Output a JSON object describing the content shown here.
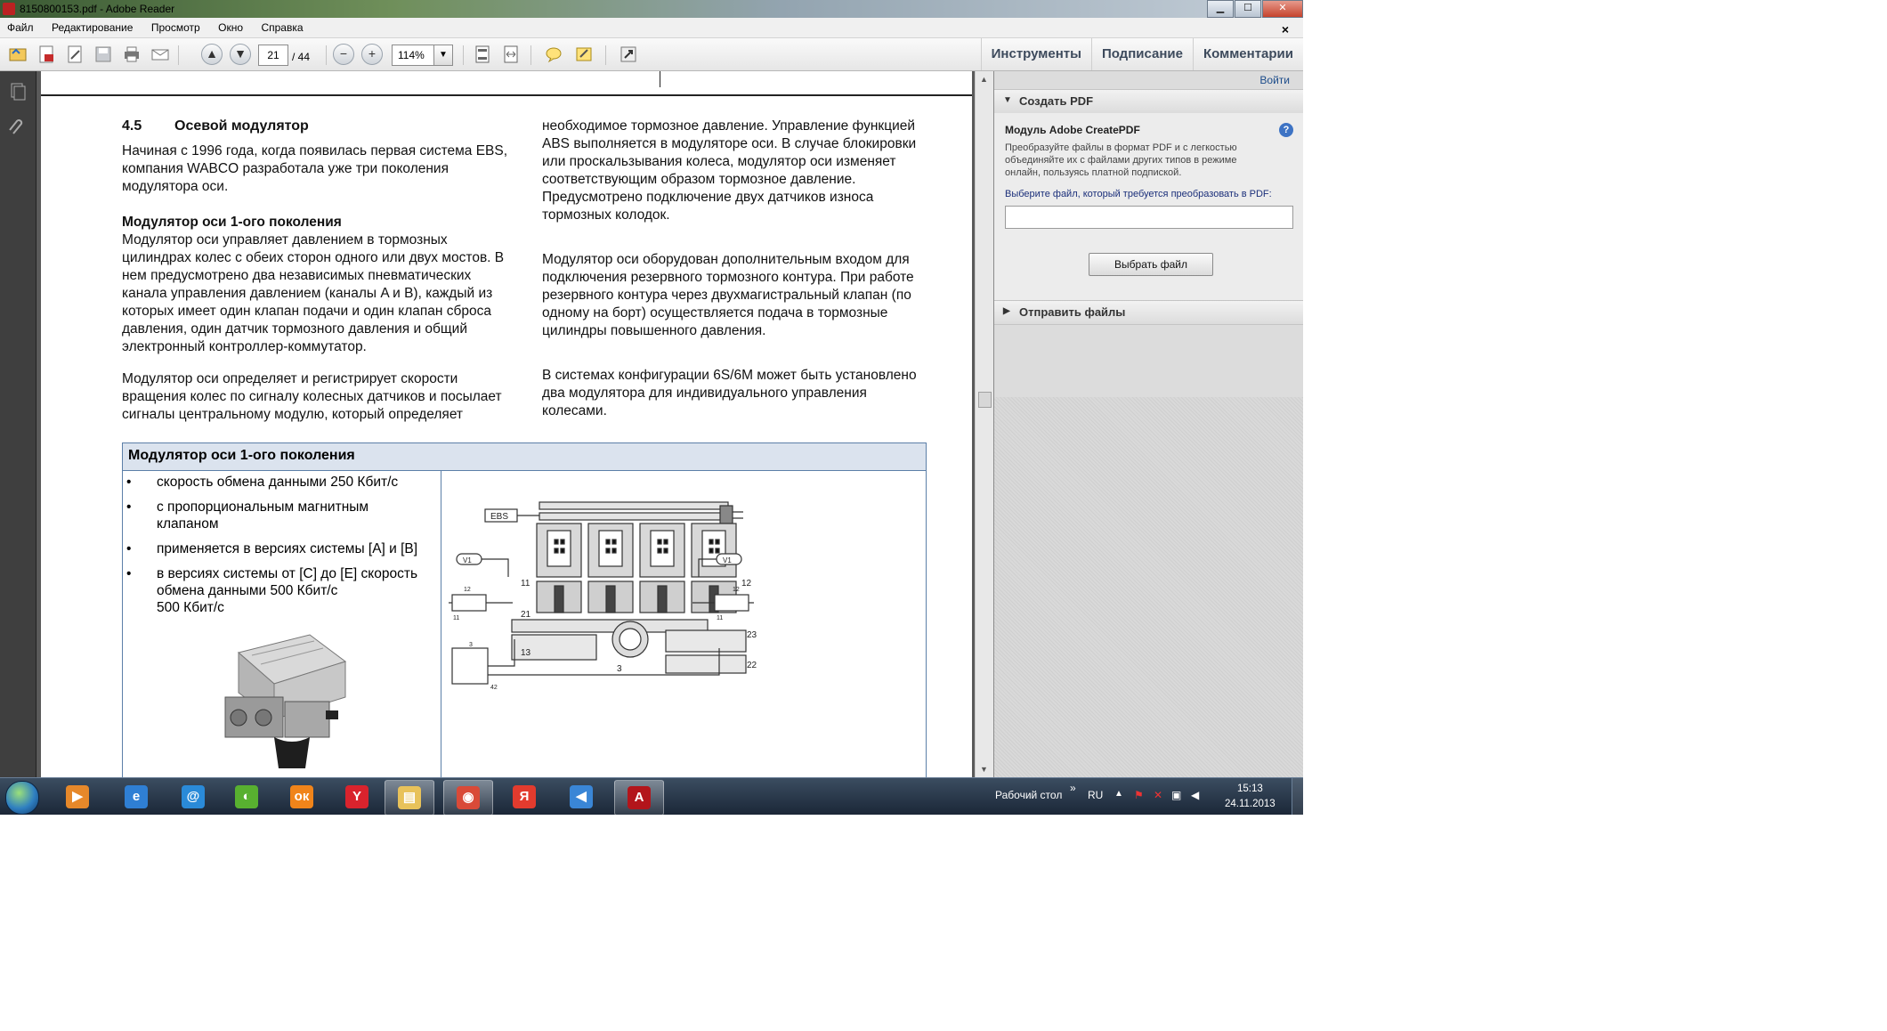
{
  "window": {
    "title": "8150800153.pdf - Adobe Reader",
    "min": "▁",
    "max": "☐",
    "close": "✕"
  },
  "menu": {
    "items": [
      "Файл",
      "Редактирование",
      "Просмотр",
      "Окно",
      "Справка"
    ],
    "close": "×"
  },
  "toolbar": {
    "page_current": "21",
    "page_total": "/ 44",
    "zoom": "114%",
    "links": {
      "tools": "Инструменты",
      "sign": "Подписание",
      "comments": "Комментарии"
    }
  },
  "document": {
    "heading_number": "4.5",
    "heading_title": "Осевой модулятор",
    "left_col": {
      "p1": [
        "Начиная с 1996 года, когда появилась первая система EBS,",
        "компания WABCO разработала уже три поколения",
        "модулятора оси."
      ],
      "subheading": "Модулятор оси 1-ого поколения",
      "p2": [
        "Модулятор оси управляет давлением в тормозных",
        "цилиндрах колес с обеих сторон одного или двух мостов. В",
        "нем предусмотрено два независимых пневматических",
        "канала управления давлением (каналы A и B), каждый из",
        "которых имеет один клапан подачи и один клапан сброса",
        "давления, один датчик тормозного давления и общий",
        "электронный контроллер-коммутатор."
      ],
      "p3": [
        "Модулятор оси определяет и регистрирует скорости",
        "вращения колес по сигналу колесных датчиков и посылает",
        "сигналы центральному модулю, который определяет"
      ]
    },
    "right_col": {
      "p1": [
        "необходимое тормозное давление. Управление функцией",
        "ABS выполняется в модуляторе оси. В случае блокировки",
        "или проскальзывания колеса, модулятор оси изменяет",
        "соответствующим образом тормозное давление.",
        "Предусмотрено подключение двух датчиков износа",
        "тормозных колодок."
      ],
      "p2": [
        "Модулятор оси оборудован дополнительным входом для",
        "подключения резервного тормозного контура. При работе",
        "резервного контура через двухмагистральный клапан (по",
        "одному на борт) осуществляется подача в тормозные",
        "цилиндры повышенного давления."
      ],
      "p3": [
        "В системах конфигурации 6S/6M может быть установлено",
        "два модулятора для индивидуального управления",
        "колесами."
      ]
    },
    "table": {
      "title": "Модулятор оси 1-ого поколения",
      "bullet_mark": "•",
      "bullets": [
        [
          "скорость обмена данными 250 Кбит/с"
        ],
        [
          "с пропорциональным магнитным",
          "клапаном"
        ],
        [
          "применяется в версиях системы [A] и [B]"
        ],
        [
          "в версиях системы от [C] до [E] скорость",
          "обмена данными 500 Кбит/с",
          "500  Кбит/с"
        ]
      ],
      "schematic_labels": {
        "ebs": "EBS",
        "v1_left": "V1",
        "v1_right": "V1",
        "p11": "11",
        "p12": "12",
        "p21": "21",
        "p23": "23",
        "p22": "22",
        "p13": "13",
        "p3": "3",
        "s12a": "12",
        "s11a": "11",
        "s12b": "12",
        "s11b": "11",
        "s3": "3",
        "s42": "42"
      }
    }
  },
  "right_panel": {
    "login": "Войти",
    "create_pdf": "Создать PDF",
    "module_title": "Модуль Adobe CreatePDF",
    "help": "?",
    "description": [
      "Преобразуйте файлы в формат PDF и с легкостью",
      "объединяйте их с файлами других типов в режиме",
      "онлайн, пользуясь платной подпиской."
    ],
    "select_label": "Выберите файл, который требуется преобразовать в PDF:",
    "select_button": "Выбрать файл",
    "send_files": "Отправить файлы"
  },
  "taskbar": {
    "apps": [
      {
        "icon": "media-player-icon",
        "glyph": "▶",
        "color": "#e6882a"
      },
      {
        "icon": "internet-explorer-icon",
        "glyph": "e",
        "color": "#2f7fd4"
      },
      {
        "icon": "mail-agent-icon",
        "glyph": "@",
        "color": "#2a8ad8"
      },
      {
        "icon": "globe-app-icon",
        "glyph": "◐",
        "color": "#58b030"
      },
      {
        "icon": "odnoklassniki-icon",
        "glyph": "ок",
        "color": "#f0841a"
      },
      {
        "icon": "yandex-browser-icon",
        "glyph": "Y",
        "color": "#d9232d"
      },
      {
        "icon": "file-explorer-icon",
        "glyph": "▤",
        "color": "#e8c25a"
      },
      {
        "icon": "chrome-icon",
        "glyph": "◉",
        "color": "#d94a38"
      },
      {
        "icon": "yandex-icon",
        "glyph": "Я",
        "color": "#e23b2e"
      },
      {
        "icon": "volume-app-icon",
        "glyph": "◀",
        "color": "#3a86d6"
      },
      {
        "icon": "adobe-reader-icon",
        "glyph": "A",
        "color": "#b3151b"
      }
    ],
    "desktop_label": "Рабочий стол",
    "chevron": "»",
    "lang": "RU",
    "time": "15:13",
    "date": "24.11.2013"
  }
}
